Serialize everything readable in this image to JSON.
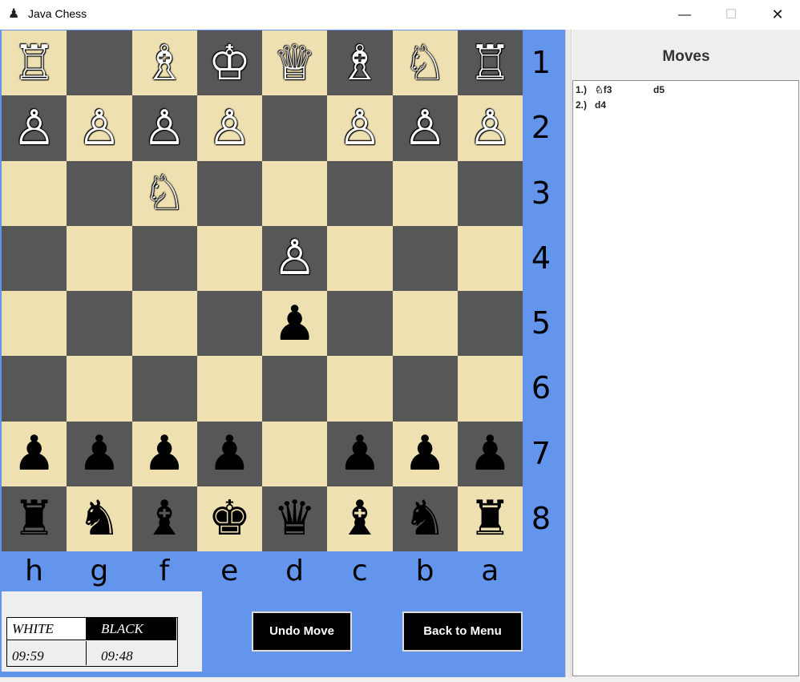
{
  "window": {
    "title": "Java Chess",
    "minimize": "—",
    "maximize": "☐",
    "close": "✕"
  },
  "board": {
    "ranks": [
      [
        {
          "piece": "♖",
          "color": "white",
          "name": "white-rook"
        },
        {
          "piece": "",
          "color": "",
          "name": "empty"
        },
        {
          "piece": "♗",
          "color": "white",
          "name": "white-bishop"
        },
        {
          "piece": "♔",
          "color": "white",
          "name": "white-king"
        },
        {
          "piece": "♕",
          "color": "white",
          "name": "white-queen"
        },
        {
          "piece": "♗",
          "color": "white",
          "name": "white-bishop"
        },
        {
          "piece": "♘",
          "color": "white",
          "name": "white-knight"
        },
        {
          "piece": "♖",
          "color": "white",
          "name": "white-rook"
        }
      ],
      [
        {
          "piece": "♙",
          "color": "white",
          "name": "white-pawn"
        },
        {
          "piece": "♙",
          "color": "white",
          "name": "white-pawn"
        },
        {
          "piece": "♙",
          "color": "white",
          "name": "white-pawn"
        },
        {
          "piece": "♙",
          "color": "white",
          "name": "white-pawn"
        },
        {
          "piece": "",
          "color": "",
          "name": "empty"
        },
        {
          "piece": "♙",
          "color": "white",
          "name": "white-pawn"
        },
        {
          "piece": "♙",
          "color": "white",
          "name": "white-pawn"
        },
        {
          "piece": "♙",
          "color": "white",
          "name": "white-pawn"
        }
      ],
      [
        {
          "piece": "",
          "color": "",
          "name": "empty"
        },
        {
          "piece": "",
          "color": "",
          "name": "empty"
        },
        {
          "piece": "♘",
          "color": "white",
          "name": "white-knight"
        },
        {
          "piece": "",
          "color": "",
          "name": "empty"
        },
        {
          "piece": "",
          "color": "",
          "name": "empty"
        },
        {
          "piece": "",
          "color": "",
          "name": "empty"
        },
        {
          "piece": "",
          "color": "",
          "name": "empty"
        },
        {
          "piece": "",
          "color": "",
          "name": "empty"
        }
      ],
      [
        {
          "piece": "",
          "color": "",
          "name": "empty"
        },
        {
          "piece": "",
          "color": "",
          "name": "empty"
        },
        {
          "piece": "",
          "color": "",
          "name": "empty"
        },
        {
          "piece": "",
          "color": "",
          "name": "empty"
        },
        {
          "piece": "♙",
          "color": "white",
          "name": "white-pawn"
        },
        {
          "piece": "",
          "color": "",
          "name": "empty"
        },
        {
          "piece": "",
          "color": "",
          "name": "empty"
        },
        {
          "piece": "",
          "color": "",
          "name": "empty"
        }
      ],
      [
        {
          "piece": "",
          "color": "",
          "name": "empty"
        },
        {
          "piece": "",
          "color": "",
          "name": "empty"
        },
        {
          "piece": "",
          "color": "",
          "name": "empty"
        },
        {
          "piece": "",
          "color": "",
          "name": "empty"
        },
        {
          "piece": "♟",
          "color": "black",
          "name": "black-pawn"
        },
        {
          "piece": "",
          "color": "",
          "name": "empty"
        },
        {
          "piece": "",
          "color": "",
          "name": "empty"
        },
        {
          "piece": "",
          "color": "",
          "name": "empty"
        }
      ],
      [
        {
          "piece": "",
          "color": "",
          "name": "empty"
        },
        {
          "piece": "",
          "color": "",
          "name": "empty"
        },
        {
          "piece": "",
          "color": "",
          "name": "empty"
        },
        {
          "piece": "",
          "color": "",
          "name": "empty"
        },
        {
          "piece": "",
          "color": "",
          "name": "empty"
        },
        {
          "piece": "",
          "color": "",
          "name": "empty"
        },
        {
          "piece": "",
          "color": "",
          "name": "empty"
        },
        {
          "piece": "",
          "color": "",
          "name": "empty"
        }
      ],
      [
        {
          "piece": "♟",
          "color": "black",
          "name": "black-pawn"
        },
        {
          "piece": "♟",
          "color": "black",
          "name": "black-pawn"
        },
        {
          "piece": "♟",
          "color": "black",
          "name": "black-pawn"
        },
        {
          "piece": "♟",
          "color": "black",
          "name": "black-pawn"
        },
        {
          "piece": "",
          "color": "",
          "name": "empty"
        },
        {
          "piece": "♟",
          "color": "black",
          "name": "black-pawn"
        },
        {
          "piece": "♟",
          "color": "black",
          "name": "black-pawn"
        },
        {
          "piece": "♟",
          "color": "black",
          "name": "black-pawn"
        }
      ],
      [
        {
          "piece": "♜",
          "color": "black",
          "name": "black-rook"
        },
        {
          "piece": "♞",
          "color": "black",
          "name": "black-knight"
        },
        {
          "piece": "♝",
          "color": "black",
          "name": "black-bishop"
        },
        {
          "piece": "♚",
          "color": "black",
          "name": "black-king"
        },
        {
          "piece": "♛",
          "color": "black",
          "name": "black-queen"
        },
        {
          "piece": "♝",
          "color": "black",
          "name": "black-bishop"
        },
        {
          "piece": "♞",
          "color": "black",
          "name": "black-knight"
        },
        {
          "piece": "♜",
          "color": "black",
          "name": "black-rook"
        }
      ]
    ],
    "rank_labels": [
      "1",
      "2",
      "3",
      "4",
      "5",
      "6",
      "7",
      "8"
    ],
    "file_labels": [
      "h",
      "g",
      "f",
      "e",
      "d",
      "c",
      "b",
      "a"
    ],
    "colors": {
      "light": "#eee0b1",
      "dark": "#575757",
      "panel": "#6495ed"
    }
  },
  "clock": {
    "white_label": "WHITE",
    "black_label": "BLACK",
    "white_time": "09:59",
    "black_time": "09:48"
  },
  "buttons": {
    "undo": "Undo Move",
    "menu": "Back to Menu"
  },
  "moves": {
    "title": "Moves",
    "rows": [
      {
        "num": "1.)",
        "white": "♘f3",
        "black": "d5"
      },
      {
        "num": "2.)",
        "white": "d4",
        "black": ""
      }
    ]
  }
}
